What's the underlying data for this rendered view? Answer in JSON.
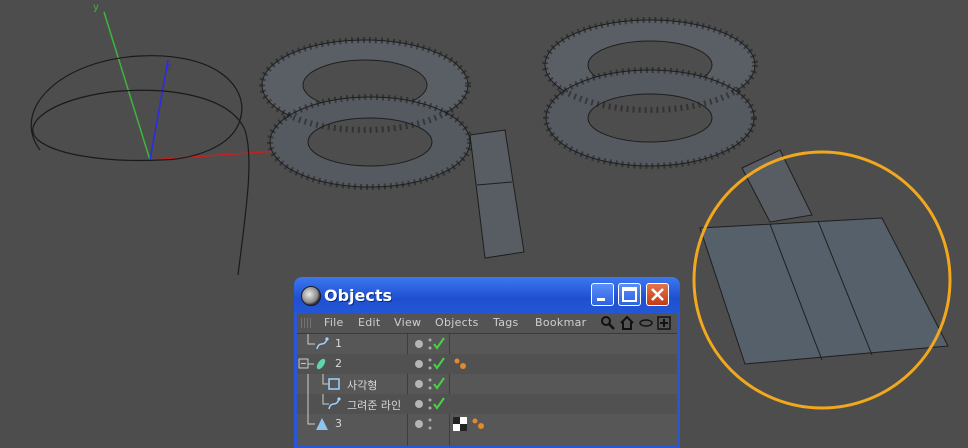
{
  "window": {
    "title": "Objects",
    "icons": {
      "app": "cinema4d-icon",
      "minimize": "minimize-icon",
      "maximize": "maximize-icon",
      "close": "close-icon"
    }
  },
  "menu": {
    "file": "File",
    "edit": "Edit",
    "view": "View",
    "objects": "Objects",
    "tags": "Tags",
    "bookmarks": "Bookmar"
  },
  "toolbar_icons": [
    "search-icon",
    "home-icon",
    "eye-icon",
    "add-icon"
  ],
  "objects": [
    {
      "name": "1",
      "icon": "spline-icon",
      "visible": true,
      "enabled": true,
      "tags": []
    },
    {
      "name": "2",
      "icon": "sweep-icon",
      "visible": true,
      "enabled": true,
      "expanded": true,
      "tags": [
        "phong-tag"
      ]
    },
    {
      "name": "사각형",
      "icon": "rectangle-icon",
      "visible": true,
      "enabled": true,
      "tags": []
    },
    {
      "name": "그려준 라인",
      "icon": "spline-icon",
      "visible": true,
      "enabled": true,
      "tags": []
    },
    {
      "name": "3",
      "icon": "primitive-icon",
      "visible": true,
      "enabled": false,
      "tags": [
        "texture-tag",
        "phong-tag"
      ]
    }
  ],
  "colors": {
    "highlight_circle": "#f2a81d",
    "xp_title": "#2a5fe0",
    "close_button": "#d9531e",
    "check": "#46d246"
  }
}
